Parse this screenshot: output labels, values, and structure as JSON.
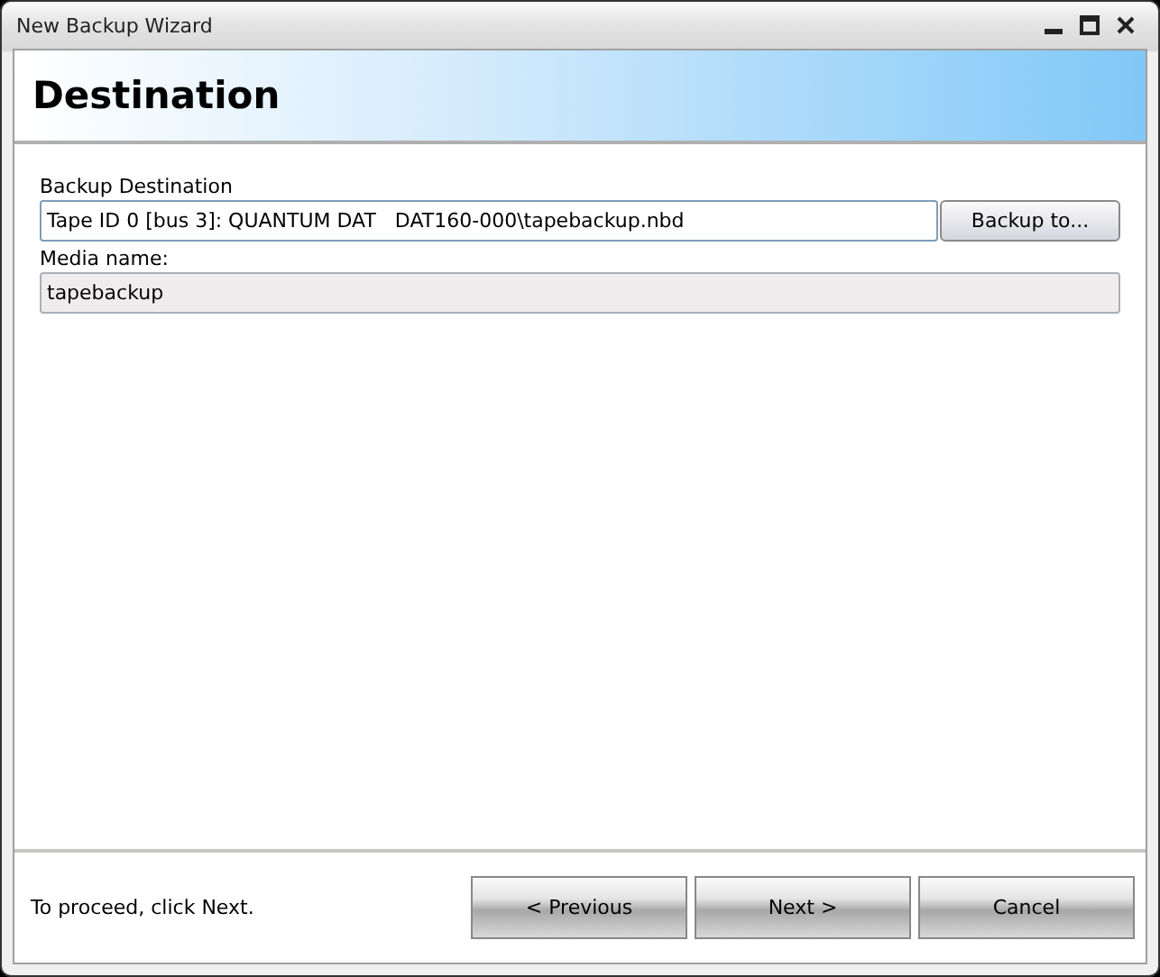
{
  "window": {
    "title": "New Backup Wizard"
  },
  "header": {
    "title": "Destination"
  },
  "form": {
    "fields": [
      {
        "label": "Backup Destination",
        "value": "Tape ID 0 [bus 3]: QUANTUM DAT   DAT160-000\\tapebackup.nbd",
        "disabled": false,
        "button": "Backup to..."
      },
      {
        "label": "Media name:",
        "value": "tapebackup",
        "disabled": true
      }
    ]
  },
  "footer": {
    "hint": "To proceed, click Next.",
    "buttons": [
      "< Previous",
      "Next >",
      "Cancel"
    ]
  }
}
